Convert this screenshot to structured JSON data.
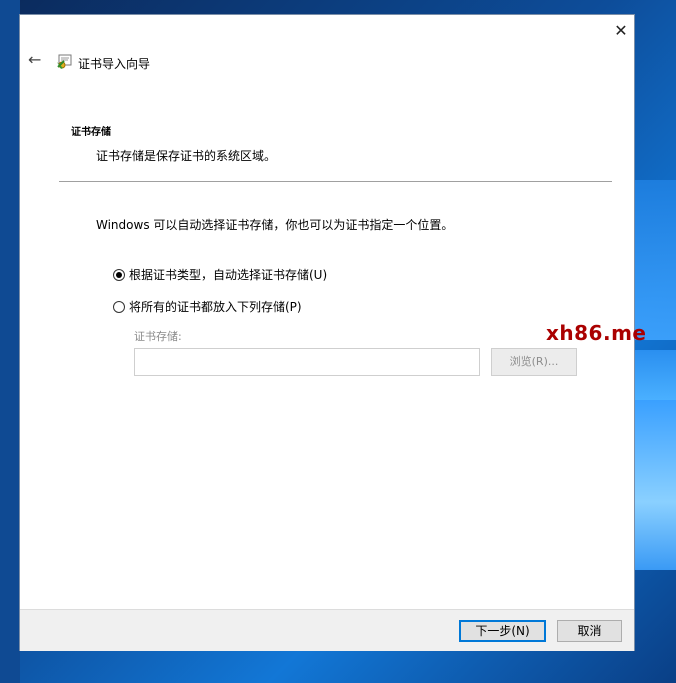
{
  "dialog": {
    "title": "证书导入向导",
    "close_glyph": "✕",
    "back_glyph": "←"
  },
  "page": {
    "heading": "证书存储",
    "subtitle": "证书存储是保存证书的系统区域。",
    "intro": "Windows 可以自动选择证书存储，你也可以为证书指定一个位置。"
  },
  "options": [
    {
      "label": "根据证书类型，自动选择证书存储(U)",
      "selected": true
    },
    {
      "label": "将所有的证书都放入下列存储(P)",
      "selected": false
    }
  ],
  "store": {
    "label": "证书存储:",
    "value": "",
    "browse_label": "浏览(R)..."
  },
  "footer": {
    "next_label": "下一步(N)",
    "cancel_label": "取消"
  },
  "watermark": "xh86.me",
  "colors": {
    "accent": "#0078d7",
    "watermark": "#aa0000",
    "footer_bg": "#f0f0f0"
  }
}
